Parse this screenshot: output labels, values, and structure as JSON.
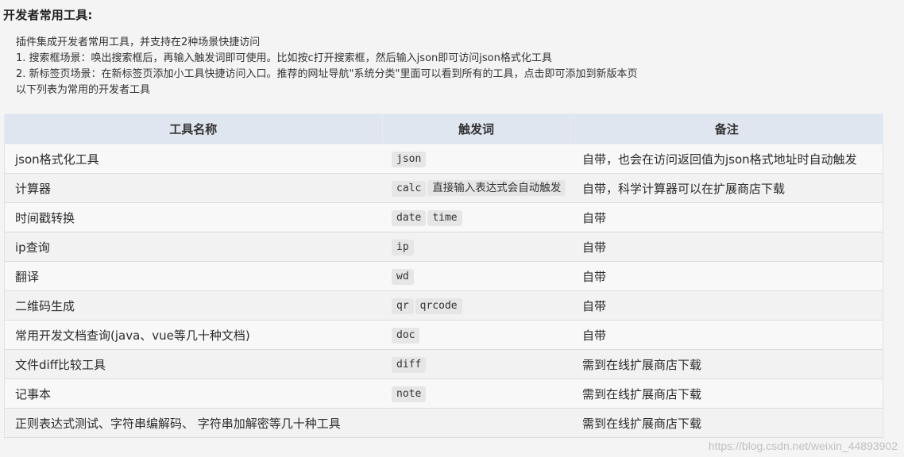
{
  "page_title": "开发者常用工具:",
  "intro_lines": [
    "插件集成开发者常用工具，并支持在2种场景快捷访问",
    "1. 搜索框场景：唤出搜索框后，再输入触发词即可使用。比如按c打开搜索框，然后输入json即可访问json格式化工具",
    "2. 新标签页场景：在新标签页添加小工具快捷访问入口。推荐的网址导航\"系统分类\"里面可以看到所有的工具，点击即可添加到新版本页",
    "以下列表为常用的开发者工具"
  ],
  "table": {
    "headers": [
      "工具名称",
      "触发词",
      "备注"
    ],
    "rows": [
      {
        "name": "json格式化工具",
        "triggers": [
          "json"
        ],
        "note": "自带，也会在访问返回值为json格式地址时自动触发"
      },
      {
        "name": "计算器",
        "triggers": [
          "calc",
          "直接输入表达式会自动触发"
        ],
        "note": "自带，科学计算器可以在扩展商店下载"
      },
      {
        "name": "时间戳转换",
        "triggers": [
          "date",
          "time"
        ],
        "note": "自带"
      },
      {
        "name": "ip查询",
        "triggers": [
          "ip"
        ],
        "note": "自带"
      },
      {
        "name": "翻译",
        "triggers": [
          "wd"
        ],
        "note": "自带"
      },
      {
        "name": "二维码生成",
        "triggers": [
          "qr",
          "qrcode"
        ],
        "note": "自带"
      },
      {
        "name": "常用开发文档查询(java、vue等几十种文档)",
        "triggers": [
          "doc"
        ],
        "note": "自带"
      },
      {
        "name": "文件diff比较工具",
        "triggers": [
          "diff"
        ],
        "note": "需到在线扩展商店下载"
      },
      {
        "name": "记事本",
        "triggers": [
          "note"
        ],
        "note": "需到在线扩展商店下载"
      },
      {
        "name": "正则表达式测试、字符串编解码、 字符串加解密等几十种工具",
        "triggers": [],
        "note": "需到在线扩展商店下载"
      }
    ]
  },
  "watermark": "https://blog.csdn.net/weixin_44893902"
}
